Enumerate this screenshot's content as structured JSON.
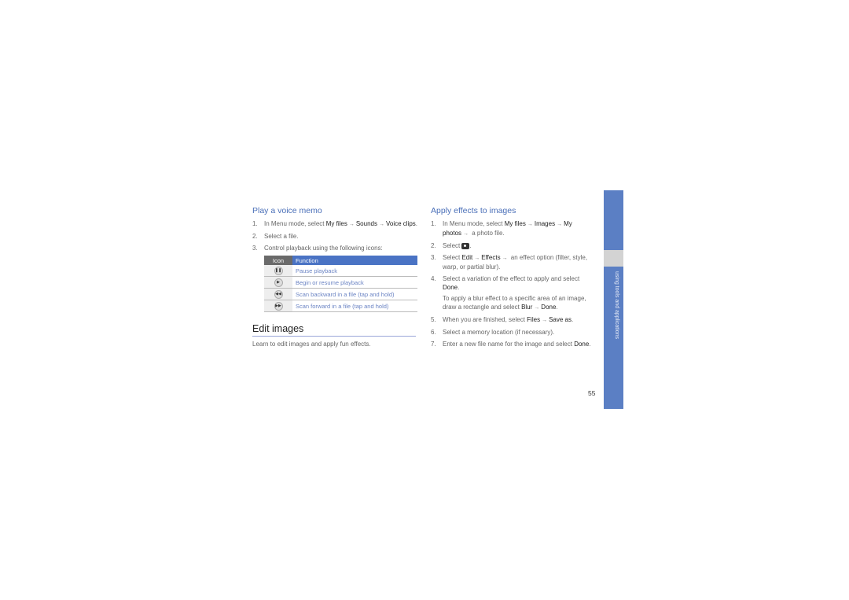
{
  "left": {
    "play_title": "Play a voice memo",
    "steps": [
      {
        "num": "1.",
        "pre": "In Menu mode, select ",
        "b1": "My files",
        "b2": "Sounds",
        "b3": "Voice clips",
        "post": "."
      },
      {
        "num": "2.",
        "text": "Select a file."
      },
      {
        "num": "3.",
        "text": "Control playback using the following icons:"
      }
    ],
    "table": {
      "headers": [
        "Icon",
        "Function"
      ],
      "rows": [
        {
          "icon": "pause-icon",
          "glyph": "❚❚",
          "function": "Pause playback"
        },
        {
          "icon": "play-icon",
          "glyph": "▶",
          "function": "Begin or resume playback"
        },
        {
          "icon": "rewind-icon",
          "glyph": "◀◀",
          "function": "Scan backward in a file (tap and hold)"
        },
        {
          "icon": "fast-forward-icon",
          "glyph": "▶▶",
          "function": "Scan forward in a file (tap and hold)"
        }
      ]
    },
    "edit_title": "Edit images",
    "edit_desc": "Learn to edit images and apply fun effects."
  },
  "right": {
    "title": "Apply effects to images",
    "s1": {
      "num": "1.",
      "pre": "In Menu mode, select ",
      "b1": "My files",
      "b2": "Images",
      "b3": "My photos",
      "post": " a photo file."
    },
    "s2": {
      "num": "2.",
      "pre": "Select ",
      "post": "."
    },
    "s3": {
      "num": "3.",
      "pre": "Select ",
      "b1": "Edit",
      "b2": "Effects",
      "post": " an effect option (filter, style, warp, or partial blur)."
    },
    "s4": {
      "num": "4.",
      "pre": "Select a variation of the effect to apply and select ",
      "b1": "Done",
      "post": ".",
      "note_pre": "To apply a blur effect to a specific area of an image, draw a rectangle and select ",
      "note_b1": "Blur",
      "note_b2": "Done",
      "note_post": "."
    },
    "s5": {
      "num": "5.",
      "pre": "When you are finished, select ",
      "b1": "Files",
      "b2": "Save as",
      "post": "."
    },
    "s6": {
      "num": "6.",
      "text": "Select a memory location (if necessary)."
    },
    "s7": {
      "num": "7.",
      "pre": "Enter a new file name for the image and select ",
      "b1": "Done",
      "post": "."
    }
  },
  "arrow": "→",
  "side_tab_label": "using tools and applications",
  "page_number": "55",
  "colors": {
    "accent": "#4a73c4",
    "tab": "#5b7fc4",
    "tab_grey": "#d3d3d3"
  }
}
